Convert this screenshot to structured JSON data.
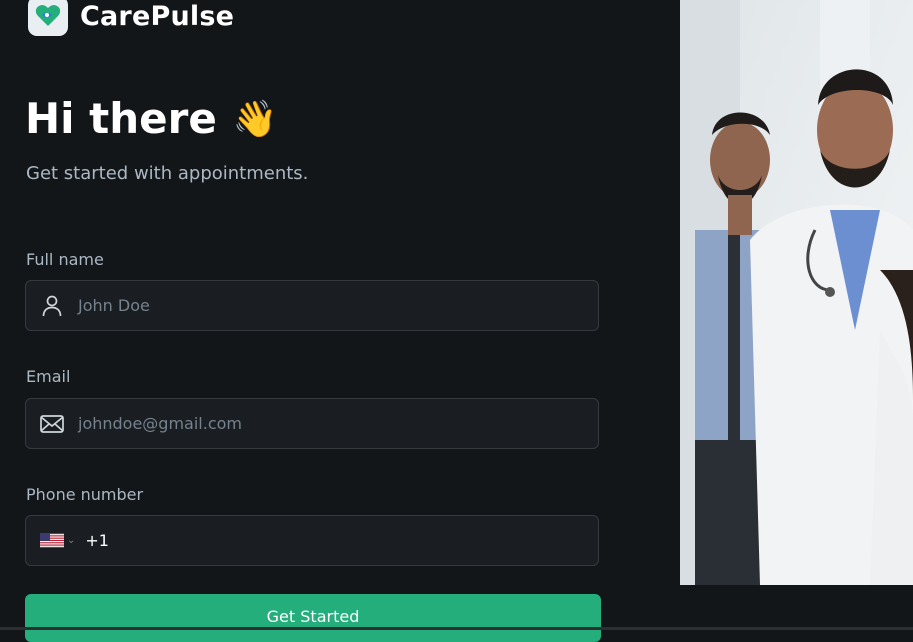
{
  "brand": {
    "name": "CarePulse"
  },
  "hero": {
    "title": "Hi there",
    "emoji": "👋",
    "subtitle": "Get started with appointments."
  },
  "form": {
    "full_name": {
      "label": "Full name",
      "placeholder": "John Doe",
      "icon": "user-icon"
    },
    "email": {
      "label": "Email",
      "placeholder": "johndoe@gmail.com",
      "icon": "mail-icon"
    },
    "phone": {
      "label": "Phone number",
      "country_flag": "us-flag-icon",
      "dial_code": "+1"
    },
    "submit_label": "Get Started"
  },
  "colors": {
    "background": "#131619",
    "accent": "#24ae7c",
    "field_bg": "#1a1d21",
    "field_border": "#363a3d"
  }
}
